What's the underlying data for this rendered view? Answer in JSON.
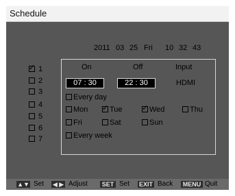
{
  "title": "Schedule",
  "date": {
    "year": "2011",
    "month": "03",
    "day": "25",
    "weekday": "Fri",
    "hour": "10",
    "minute": "32",
    "second": "43"
  },
  "slots": [
    {
      "num": "1",
      "checked": true
    },
    {
      "num": "2",
      "checked": false
    },
    {
      "num": "3",
      "checked": false
    },
    {
      "num": "4",
      "checked": false
    },
    {
      "num": "5",
      "checked": false
    },
    {
      "num": "6",
      "checked": false
    },
    {
      "num": "7",
      "checked": false
    }
  ],
  "panel": {
    "on_label": "On",
    "off_label": "Off",
    "input_label": "Input",
    "on_time": "07 : 30",
    "off_time": "22 : 30",
    "input_value": "HDMI"
  },
  "options": {
    "every_day": "Every day",
    "every_week": "Every week",
    "days": [
      {
        "label": "Mon",
        "checked": false
      },
      {
        "label": "Tue",
        "checked": true
      },
      {
        "label": "Wed",
        "checked": true
      },
      {
        "label": "Thu",
        "checked": false
      },
      {
        "label": "Fri",
        "checked": false
      },
      {
        "label": "Sat",
        "checked": false
      },
      {
        "label": "Sun",
        "checked": false
      }
    ]
  },
  "footer": {
    "up_down_key": "▲▼",
    "set_label": "Set",
    "left_right_key": "◀ ▶",
    "adjust_label": "Adjust",
    "set_key": "SET",
    "set_label2": "Set",
    "exit_key": "EXIT",
    "back_label": "Back",
    "menu_key": "MENU",
    "quit_label": "Quit"
  },
  "check_glyph": "✓"
}
